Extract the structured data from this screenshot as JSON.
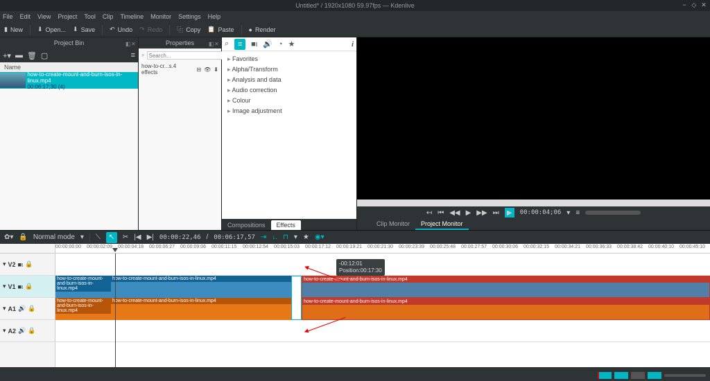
{
  "title": "Untitled* / 1920x1080 59.97fps — Kdenlive",
  "menu": [
    "File",
    "Edit",
    "View",
    "Project",
    "Tool",
    "Clip",
    "Timeline",
    "Monitor",
    "Settings",
    "Help"
  ],
  "toolbar": {
    "new": "New",
    "open": "Open...",
    "save": "Save",
    "undo": "Undo",
    "redo": "Redo",
    "copy": "Copy",
    "paste": "Paste",
    "render": "Render"
  },
  "bin": {
    "title": "Project Bin",
    "name_col": "Name",
    "clip": "how-to-create-mount-and-burn-isos-in-linux.mp4",
    "dur": "00:06:17;30 (4)"
  },
  "props": {
    "title": "Properties",
    "file": "how-to-cr...s.4 effects",
    "search": "Search..."
  },
  "effects": {
    "tabs": {
      "comp": "Compositions",
      "eff": "Effects"
    },
    "cats": [
      "Favorites",
      "Alpha/Transform",
      "Analysis and data",
      "Audio correction",
      "Colour",
      "Image adjustment"
    ]
  },
  "monitor": {
    "tabs": {
      "clip": "Clip Monitor",
      "proj": "Project Monitor"
    },
    "tc": "00:00:04;06"
  },
  "timeline": {
    "mode": "Normal mode",
    "tc1": "00:00:22,46",
    "tc2": "00:06:17,57",
    "ticks": [
      "00:00:00:00",
      "00:00:02:09",
      "00:00:04:18",
      "00:00:06:27",
      "00:00:09:06",
      "00:00:11:15",
      "00:00:12:54",
      "00:00:15:03",
      "00:00:17:12",
      "00:00:19:21",
      "00:00:21:30",
      "00:00:23:39",
      "00:00:25:48",
      "00:00:27:57",
      "00:00:30:06",
      "00:00:32:15",
      "00:00:34:21",
      "00:00:36:33",
      "00:00:38:42",
      "00:00:40:10",
      "00:00:45:10"
    ],
    "tracks": {
      "v2": "V2",
      "v1": "V1",
      "a1": "A1",
      "a2": "A2"
    },
    "clipname": "how-to-create-mount-and-burn-isos-in-linux.mp4",
    "tooltip": {
      "tc": "-00:12:01",
      "pos": "Position:00:17:30"
    }
  }
}
